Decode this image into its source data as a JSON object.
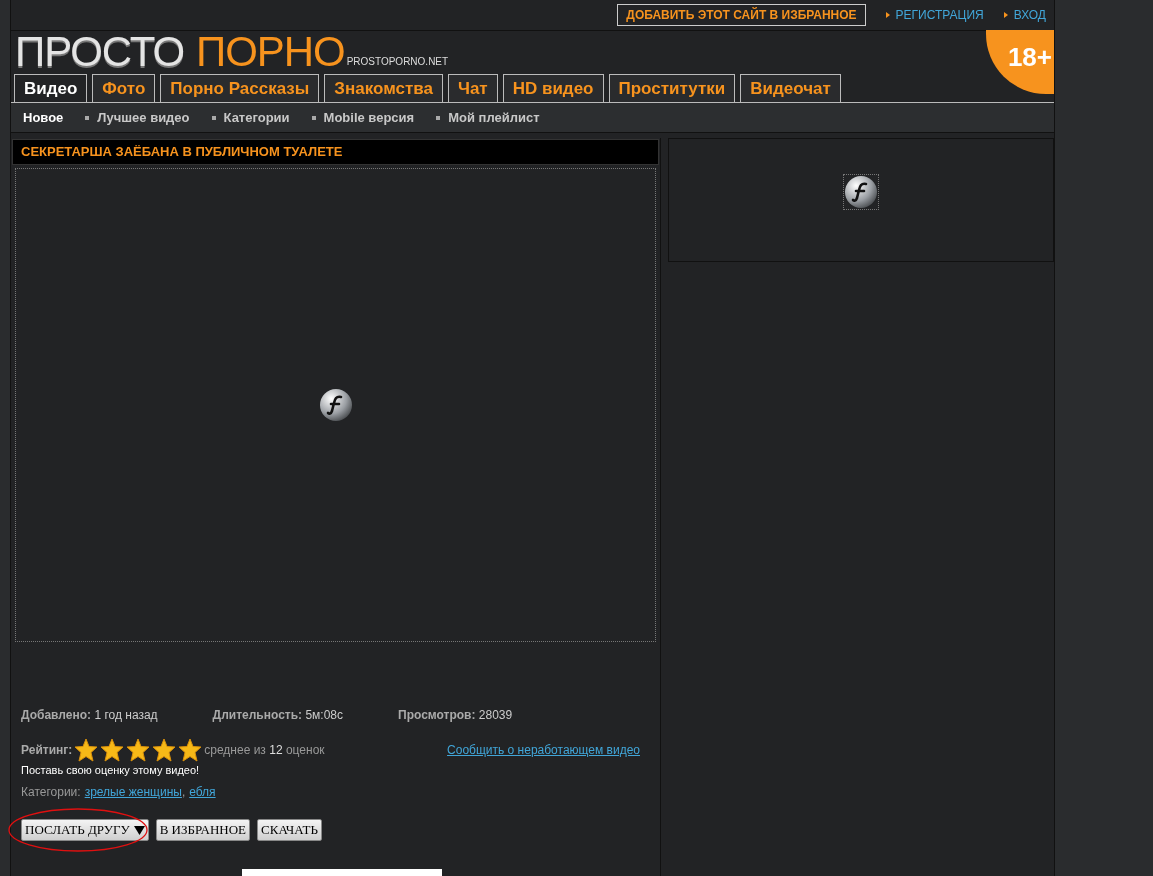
{
  "top_bar": {
    "bookmark_button": "ДОБАВИТЬ ЭТОТ САЙТ В ИЗБРАННОЕ",
    "links": [
      "РЕГИСТРАЦИЯ",
      "ВХОД"
    ]
  },
  "logo": {
    "word_1": "ПРОСТО",
    "word_2": "ПОРНО",
    "domain": "PROSTOPORNO.NET"
  },
  "age_badge": "18+",
  "tabs": [
    {
      "label": "Видео",
      "selected": true
    },
    {
      "label": "Фото",
      "selected": false
    },
    {
      "label": "Порно Рассказы",
      "selected": false
    },
    {
      "label": "Знакомства",
      "selected": false
    },
    {
      "label": "Чат",
      "selected": false
    },
    {
      "label": "HD видео",
      "selected": false
    },
    {
      "label": "Проститутки",
      "selected": false
    },
    {
      "label": "Видеочат",
      "selected": false
    }
  ],
  "subnav": [
    {
      "label": "Новое",
      "selected": true
    },
    {
      "label": "Лучшее видео",
      "selected": false
    },
    {
      "label": "Категории",
      "selected": false
    },
    {
      "label": "Mobile версия",
      "selected": false
    },
    {
      "label": "Мой плейлист",
      "selected": false
    }
  ],
  "video": {
    "title": "СЕКРЕТАРША ЗАЁБАНА В ПУБЛИЧНОМ ТУАЛЕТЕ"
  },
  "info": [
    {
      "label": "Добавлено:",
      "value": "1 год назад"
    },
    {
      "label": "Длительность:",
      "value": "5м:08с"
    },
    {
      "label": "Просмотров:",
      "value": "28039"
    }
  ],
  "rating": {
    "label": "Рейтинг:",
    "stars": 5,
    "average_prefix": "среднее из",
    "count": "12",
    "average_suffix": "оценок",
    "prompt": "Поставь свою оценку этому видео!"
  },
  "report_link": "Сообщить о неработающем видео",
  "categories": {
    "label": "Категории:",
    "items": [
      "зрелые женщины",
      "ебля"
    ],
    "separator": ","
  },
  "buttons": [
    {
      "label": "ПОСЛАТЬ ДРУГУ",
      "kind": "dropdown",
      "circled": true
    },
    {
      "label": "В ИЗБРАННОЕ",
      "kind": "plain",
      "circled": false
    },
    {
      "label": "СКАЧАТЬ",
      "kind": "plain",
      "circled": false
    }
  ]
}
